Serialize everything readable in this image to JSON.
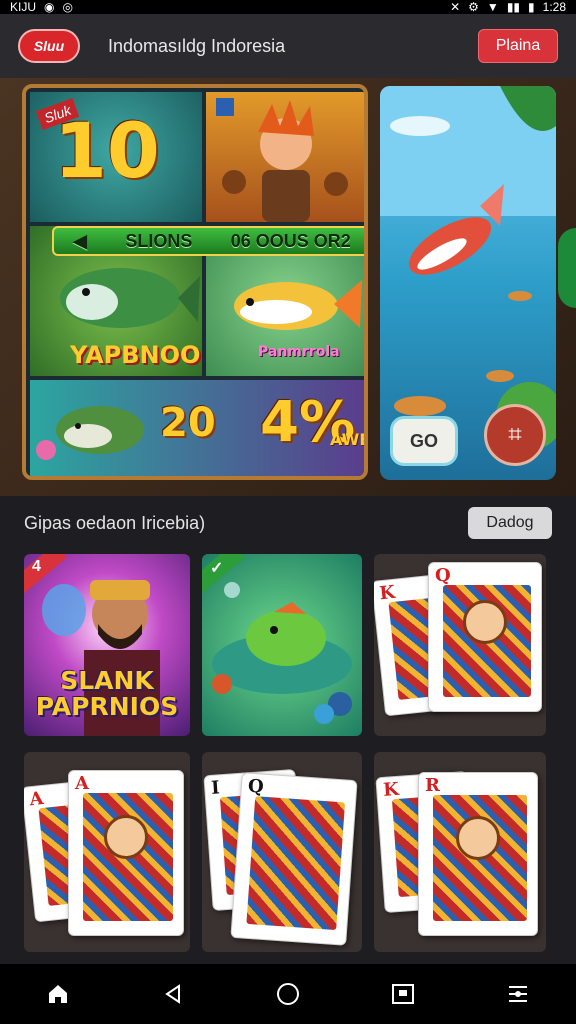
{
  "status_bar": {
    "left_text": "KIJU",
    "time": "1:28"
  },
  "app_bar": {
    "logo_text": "Sluu",
    "title": "Indomasıldg Indoresia",
    "play_button": "Plaina"
  },
  "hero": {
    "tile_1_number": "10",
    "tile_1_corner": "Sluk",
    "banner_left": "SLIONS",
    "banner_right": "06 OOUS OR2",
    "tile_3_label": "YAPBNOO",
    "tile_4_label": "Panmrrola",
    "tile_5_number": "20",
    "tile_5_percent": "4%",
    "tile_5_label": "AWEC",
    "go_button": "GO",
    "grid_button": "⌗"
  },
  "section": {
    "title": "Gipas oedaon Iricebia)",
    "badge": "Dadog"
  },
  "games": [
    {
      "title": "SLANK PAPRNIOS",
      "corner": "4"
    },
    {
      "title": "",
      "corner": "✓"
    },
    {
      "card_a": "K",
      "card_b": "Q"
    },
    {
      "card_a": "A",
      "card_b": "A"
    },
    {
      "card_a": "I",
      "card_b": "Q"
    },
    {
      "card_a": "K",
      "card_b": "R"
    }
  ],
  "nav": {
    "home_icon": "home-icon",
    "back_icon": "back-triangle-icon",
    "circle_icon": "home-circle-icon",
    "recents_icon": "recents-square-icon",
    "menu_icon": "menu-icon"
  },
  "colors": {
    "accent": "#d8333a",
    "background": "#1e1e22",
    "appbar": "#2a2a2f",
    "gold": "#ffcc2e"
  }
}
